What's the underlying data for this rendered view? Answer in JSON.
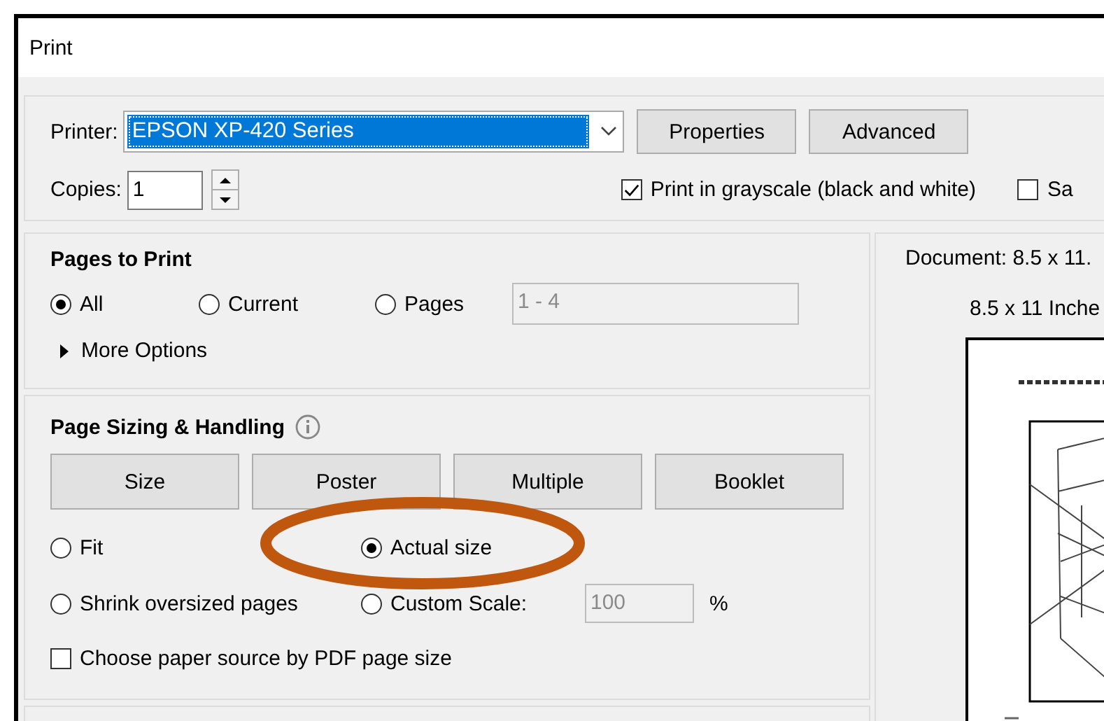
{
  "window": {
    "title": "Print"
  },
  "printer": {
    "label": "Printer:",
    "value": "EPSON XP-420 Series"
  },
  "buttons": [
    {
      "label": "Properties"
    },
    {
      "label": "Advanced"
    }
  ],
  "copies": {
    "label": "Copies:",
    "value": "1"
  },
  "options": [
    {
      "label": "Print in grayscale (black and white)",
      "checked": true
    },
    {
      "label": "Sa",
      "checked": false
    }
  ],
  "pages_to_print": {
    "title": "Pages to Print",
    "radios": [
      {
        "label": "All",
        "selected": true
      },
      {
        "label": "Current",
        "selected": false
      },
      {
        "label": "Pages",
        "selected": false
      }
    ],
    "range": {
      "value": "1 - 4",
      "disabled": true
    },
    "more_options": "More Options"
  },
  "page_sizing": {
    "title": "Page Sizing & Handling",
    "modes": [
      {
        "label": "Size"
      },
      {
        "label": "Poster"
      },
      {
        "label": "Multiple"
      },
      {
        "label": "Booklet"
      }
    ],
    "radios": [
      {
        "label": "Fit",
        "selected": false
      },
      {
        "label": "Actual size",
        "selected": true
      },
      {
        "label": "Shrink oversized pages",
        "selected": false
      },
      {
        "label": "Custom Scale:",
        "selected": false
      }
    ],
    "scale": {
      "value": "100",
      "unit": "%",
      "disabled": true
    },
    "paper_source": {
      "label": "Choose paper source by PDF page size",
      "checked": false
    }
  },
  "preview": {
    "document": "Document: 8.5 x 11.",
    "paper": "8.5 x 11 Inche"
  },
  "annotations": [
    {
      "kind": "ellipse"
    }
  ]
}
